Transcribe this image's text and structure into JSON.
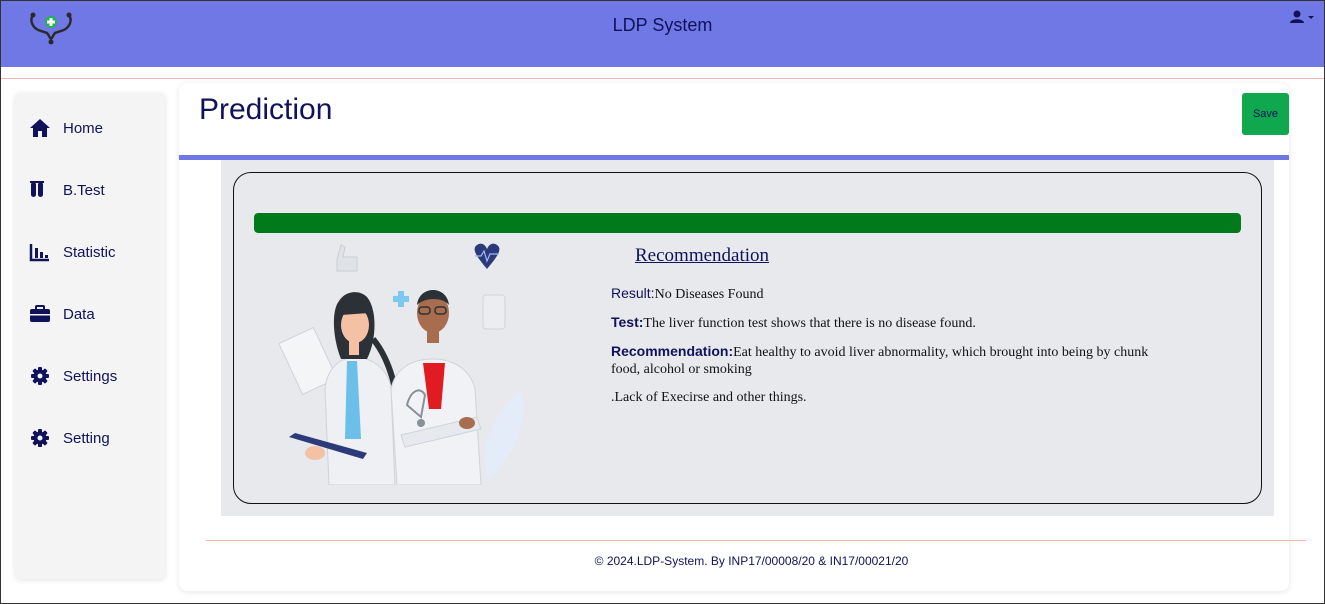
{
  "header": {
    "title": "LDP System",
    "logo_icon": "stethoscope-icon",
    "user_icon": "user-icon"
  },
  "sidebar": {
    "items": [
      {
        "label": "Home",
        "icon": "home-icon"
      },
      {
        "label": "B.Test",
        "icon": "test-tubes-icon"
      },
      {
        "label": "Statistic",
        "icon": "chart-icon"
      },
      {
        "label": "Data",
        "icon": "briefcase-icon"
      },
      {
        "label": "Settings",
        "icon": "gear-icon"
      },
      {
        "label": "Setting",
        "icon": "gear-icon"
      }
    ]
  },
  "main": {
    "page_title": "Prediction",
    "save_label": "Save",
    "progress_fraction": 1.0
  },
  "recommendation": {
    "heading": "Recommendation",
    "result_label": "Result:",
    "result_value": "No Diseases Found",
    "test_label": "Test:",
    "test_value": "The liver function test shows that there is no disease found.",
    "rec_label": "Recommendation:",
    "rec_value": "Eat healthy to avoid liver abnormality, which brought into being by chunk food, alcohol or smoking",
    "extra": ".Lack of Execirse and other things."
  },
  "footer": {
    "text": "© 2024.LDP-System. By INP17/00008/20 & IN17/00021/20"
  },
  "colors": {
    "header_bg": "#7078e6",
    "accent_text": "#10125a",
    "save_button": "#10a84e",
    "progress_fill": "#007a1a",
    "panel_bg": "#e7e9ec"
  }
}
